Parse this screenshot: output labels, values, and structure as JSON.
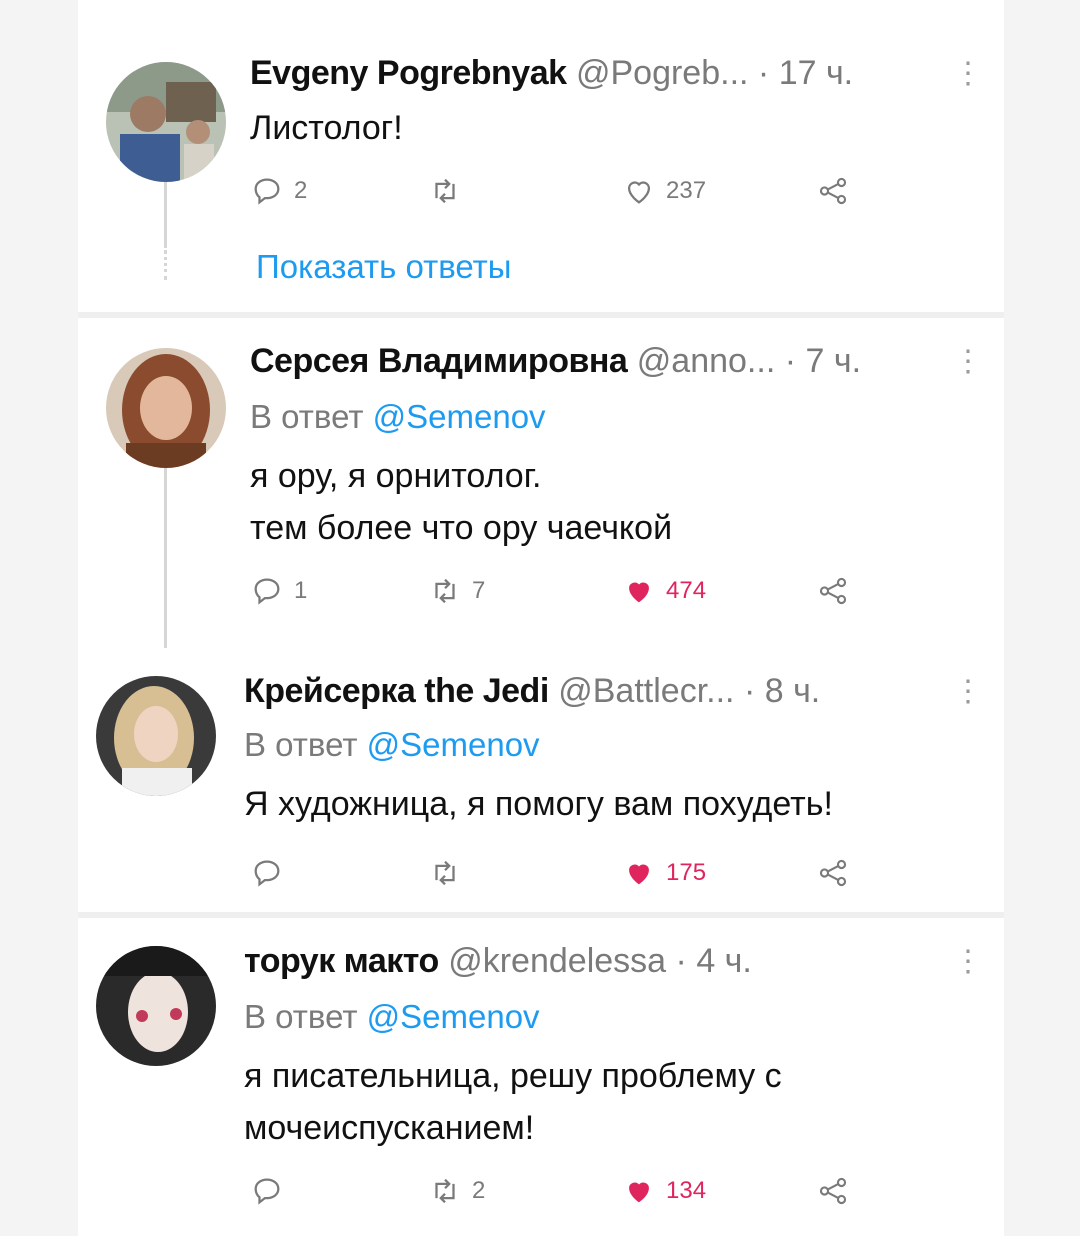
{
  "colors": {
    "accent": "#1d9bf0",
    "like": "#e0245e",
    "muted": "#7a7a7a"
  },
  "tweets": [
    {
      "name": "Evgeny Pogrebnyak",
      "handle": "@Pogreb...",
      "time": "17 ч.",
      "reply_prefix": "",
      "reply_mention": "",
      "lines": [
        "Листолог!"
      ],
      "replies": "2",
      "retweets": "",
      "likes": "237",
      "liked": false,
      "show_replies": "Показать ответы"
    },
    {
      "name": "Серсея Владимировна",
      "handle": "@anno...",
      "time": "7 ч.",
      "reply_prefix": "В ответ",
      "reply_mention": "@Semenov",
      "lines": [
        "я ору, я орнитолог.",
        "тем более что ору чаечкой"
      ],
      "replies": "1",
      "retweets": "7",
      "likes": "474",
      "liked": true
    },
    {
      "name": "Крейсерка the Jedi",
      "handle": "@Battlecr...",
      "time": "8 ч.",
      "reply_prefix": "В ответ",
      "reply_mention": "@Semenov",
      "lines": [
        "Я художница, я помогу вам похудеть!"
      ],
      "replies": "",
      "retweets": "",
      "likes": "175",
      "liked": true
    },
    {
      "name": "торук макто",
      "handle": "@krendelessa",
      "time": "4 ч.",
      "reply_prefix": "В ответ",
      "reply_mention": "@Semenov",
      "lines": [
        "я писательница, решу проблему с",
        "мочеиспусканием!"
      ],
      "replies": "",
      "retweets": "2",
      "likes": "134",
      "liked": true
    }
  ],
  "dot": "·",
  "more_icon": "⋮"
}
